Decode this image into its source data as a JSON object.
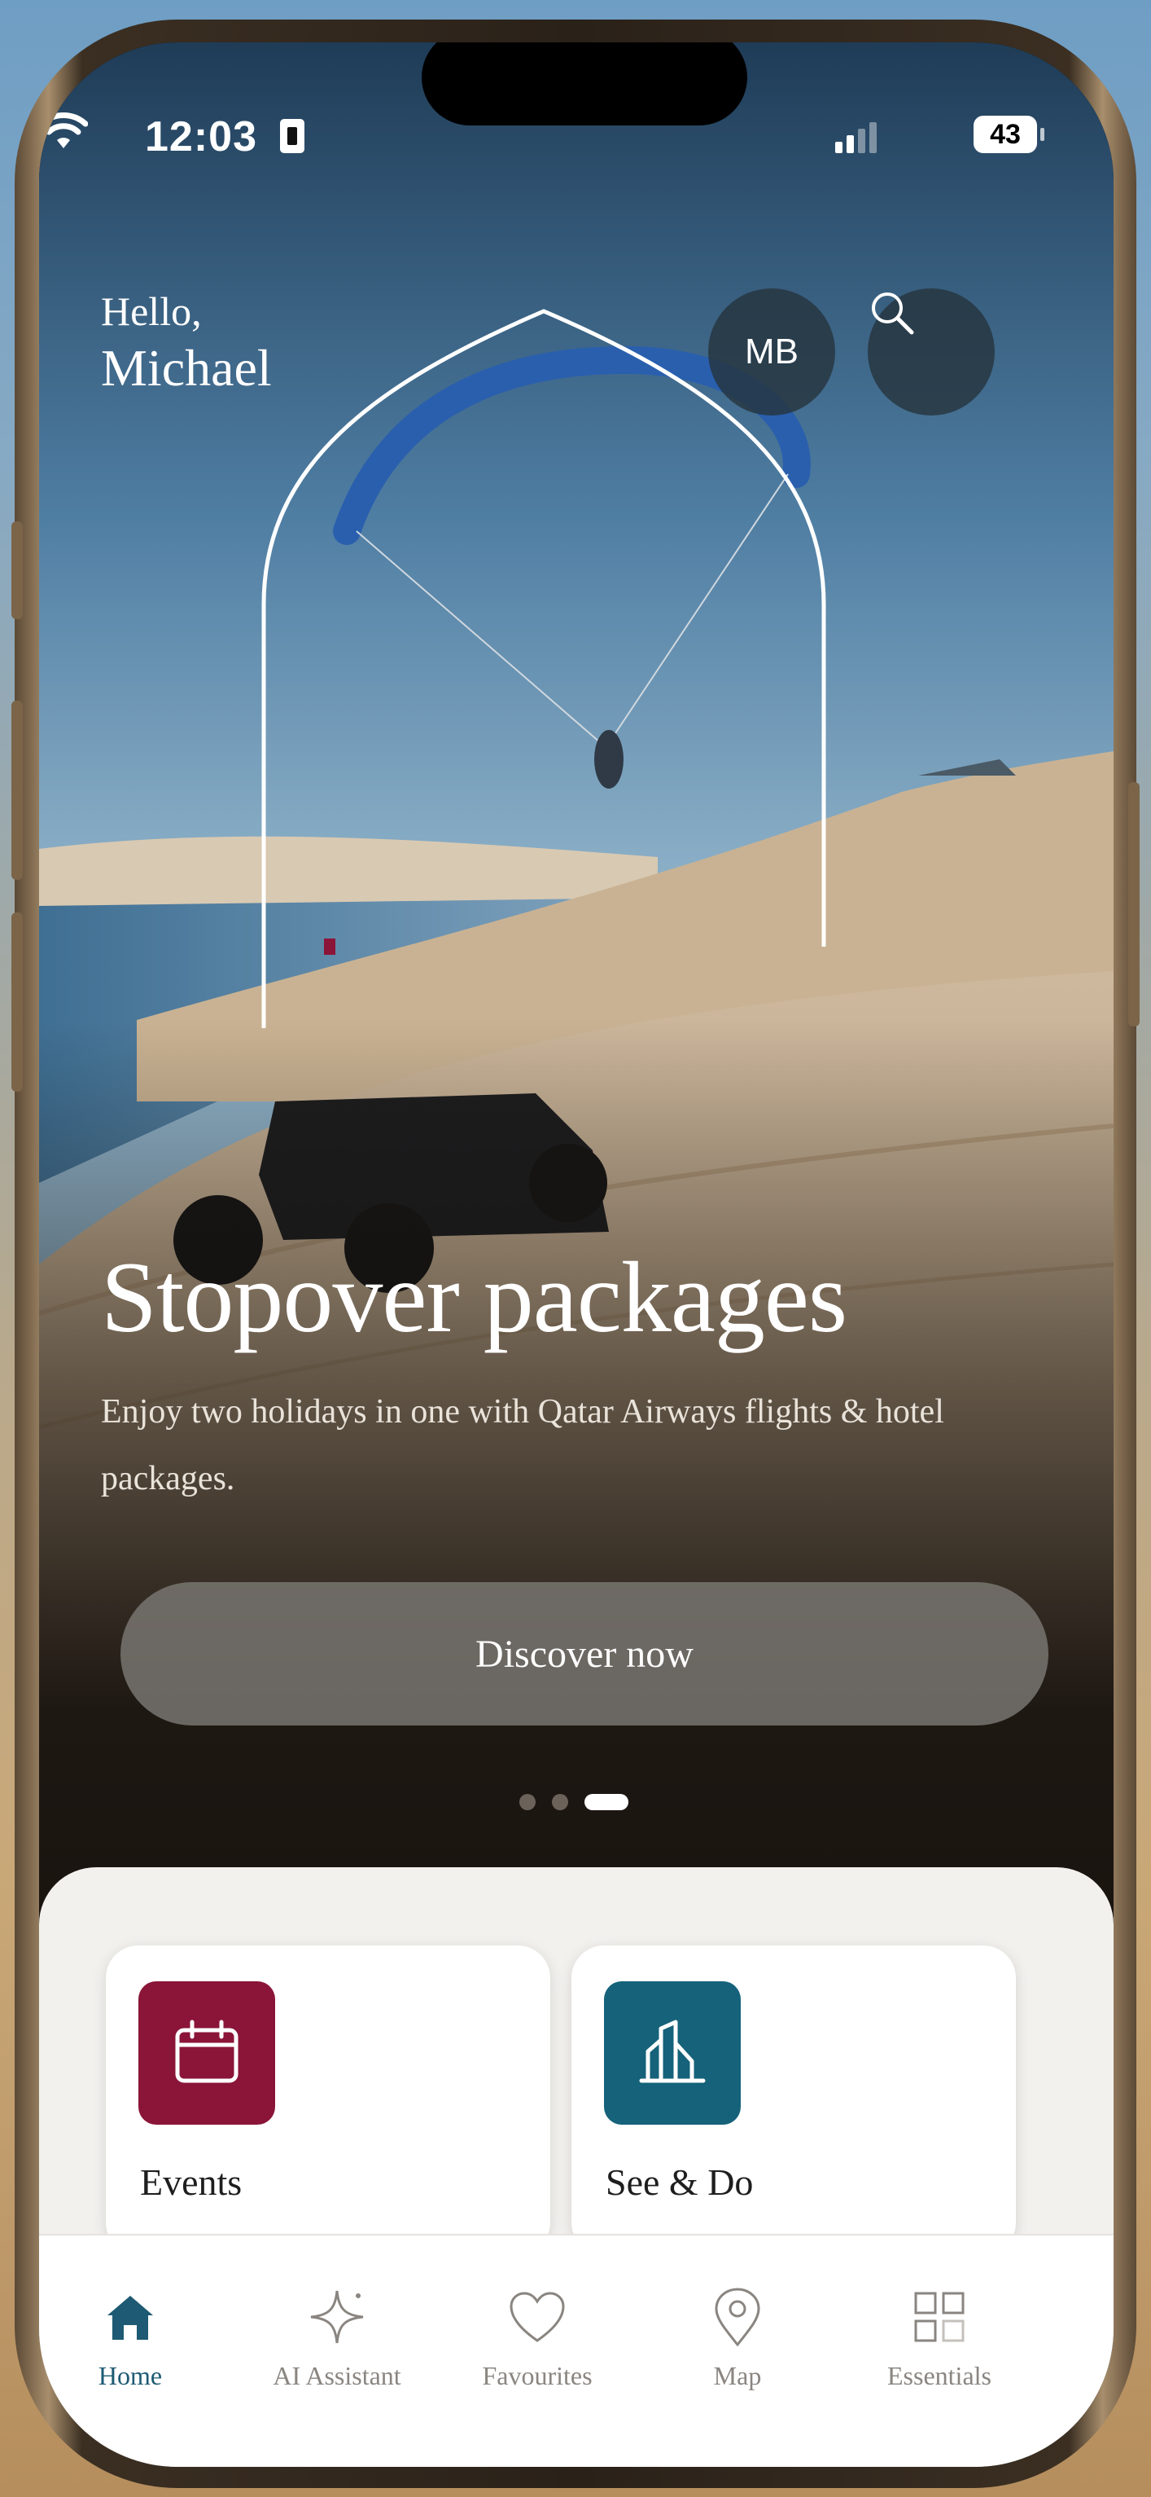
{
  "status_bar": {
    "time": "12:03",
    "battery": "43"
  },
  "header": {
    "greeting": "Hello,",
    "user_name": "Michael",
    "avatar_initials": "MB"
  },
  "hero": {
    "title": "Stopover packages",
    "description": "Enjoy two holidays in one with Qatar Airways flights & hotel packages.",
    "cta_label": "Discover now",
    "carousel": {
      "total": 3,
      "active": 3
    }
  },
  "cards": [
    {
      "label": "Events",
      "icon": "calendar-icon",
      "color": "#8a1538"
    },
    {
      "label": "See & Do",
      "icon": "building-icon",
      "color": "#15627a"
    }
  ],
  "tabs": [
    {
      "label": "Home",
      "icon": "home-icon",
      "active": true
    },
    {
      "label": "AI Assistant",
      "icon": "sparkle-icon",
      "active": false
    },
    {
      "label": "Favourites",
      "icon": "heart-icon",
      "active": false
    },
    {
      "label": "Map",
      "icon": "map-pin-icon",
      "active": false
    },
    {
      "label": "Essentials",
      "icon": "grid-icon",
      "active": false
    }
  ],
  "colors": {
    "accent": "#1e5a73",
    "events_tile": "#8a1538",
    "see_do_tile": "#15627a"
  }
}
